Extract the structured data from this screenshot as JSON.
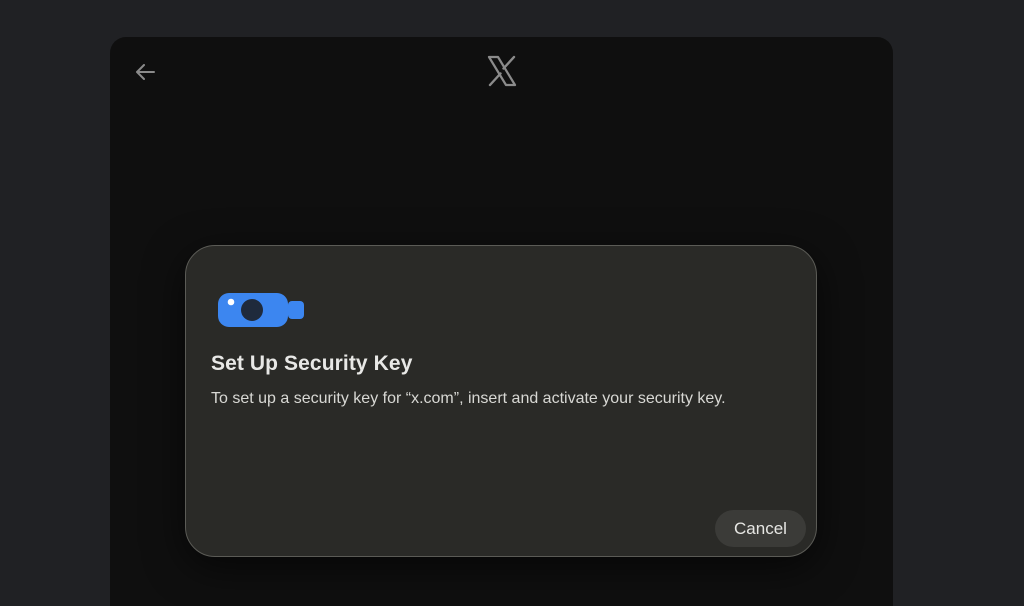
{
  "app": {
    "logo_icon": "x-logo-icon",
    "back_icon": "arrow-left-icon"
  },
  "dialog": {
    "icon": "usb-security-key-icon",
    "title": "Set Up Security Key",
    "message": "To set up a security key for “x.com”, insert and activate your security key.",
    "cancel_label": "Cancel"
  },
  "colors": {
    "page_background": "#202124",
    "shell_background": "#0f0f0f",
    "dialog_background": "#2a2a27",
    "key_accent": "#3c86f0",
    "button_background": "#3b3b38"
  }
}
